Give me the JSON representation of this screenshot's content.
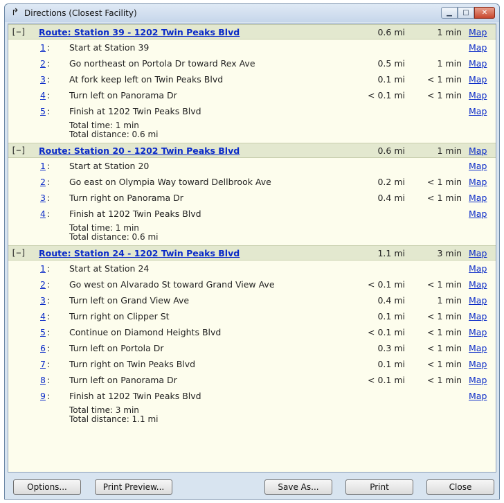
{
  "window": {
    "title": "Directions (Closest Facility)",
    "title_icon": "turn-arrow-icon",
    "controls": [
      "minimize",
      "maximize",
      "close"
    ]
  },
  "routes": [
    {
      "toggle": "[−]",
      "title": "Route: Station 39 - 1202 Twin Peaks Blvd",
      "distance": "0.6 mi",
      "time": "1 min",
      "map": "Map",
      "steps": [
        {
          "num": "1",
          "text": "Start at Station 39",
          "distance": "",
          "time": "",
          "map": "Map"
        },
        {
          "num": "2",
          "text": "Go northeast on Portola Dr toward Rex Ave",
          "distance": "0.5 mi",
          "time": "1 min",
          "map": "Map"
        },
        {
          "num": "3",
          "text": "At fork keep left on Twin Peaks Blvd",
          "distance": "0.1 mi",
          "time": "< 1 min",
          "map": "Map"
        },
        {
          "num": "4",
          "text": "Turn left on Panorama Dr",
          "distance": "< 0.1 mi",
          "time": "< 1 min",
          "map": "Map"
        },
        {
          "num": "5",
          "text": "Finish at 1202 Twin Peaks Blvd",
          "distance": "",
          "time": "",
          "map": "Map"
        }
      ],
      "total_time": "Total time: 1 min",
      "total_distance": "Total distance: 0.6 mi"
    },
    {
      "toggle": "[−]",
      "title": "Route: Station 20 - 1202 Twin Peaks Blvd",
      "distance": "0.6 mi",
      "time": "1 min",
      "map": "Map",
      "steps": [
        {
          "num": "1",
          "text": "Start at Station 20",
          "distance": "",
          "time": "",
          "map": "Map"
        },
        {
          "num": "2",
          "text": "Go east on Olympia Way toward Dellbrook Ave",
          "distance": "0.2 mi",
          "time": "< 1 min",
          "map": "Map"
        },
        {
          "num": "3",
          "text": "Turn right on Panorama Dr",
          "distance": "0.4 mi",
          "time": "< 1 min",
          "map": "Map"
        },
        {
          "num": "4",
          "text": "Finish at 1202 Twin Peaks Blvd",
          "distance": "",
          "time": "",
          "map": "Map"
        }
      ],
      "total_time": "Total time: 1 min",
      "total_distance": "Total distance: 0.6 mi"
    },
    {
      "toggle": "[−]",
      "title": "Route: Station 24 - 1202 Twin Peaks Blvd",
      "distance": "1.1 mi",
      "time": "3 min",
      "map": "Map",
      "steps": [
        {
          "num": "1",
          "text": "Start at Station 24",
          "distance": "",
          "time": "",
          "map": "Map"
        },
        {
          "num": "2",
          "text": "Go west on Alvarado St toward Grand View Ave",
          "distance": "< 0.1 mi",
          "time": "< 1 min",
          "map": "Map"
        },
        {
          "num": "3",
          "text": "Turn left on Grand View Ave",
          "distance": "0.4 mi",
          "time": "1 min",
          "map": "Map"
        },
        {
          "num": "4",
          "text": "Turn right on Clipper St",
          "distance": "0.1 mi",
          "time": "< 1 min",
          "map": "Map"
        },
        {
          "num": "5",
          "text": "Continue on Diamond Heights Blvd",
          "distance": "< 0.1 mi",
          "time": "< 1 min",
          "map": "Map"
        },
        {
          "num": "6",
          "text": "Turn left on Portola Dr",
          "distance": "0.3 mi",
          "time": "< 1 min",
          "map": "Map"
        },
        {
          "num": "7",
          "text": "Turn right on Twin Peaks Blvd",
          "distance": "0.1 mi",
          "time": "< 1 min",
          "map": "Map"
        },
        {
          "num": "8",
          "text": "Turn left on Panorama Dr",
          "distance": "< 0.1 mi",
          "time": "< 1 min",
          "map": "Map"
        },
        {
          "num": "9",
          "text": "Finish at 1202 Twin Peaks Blvd",
          "distance": "",
          "time": "",
          "map": "Map"
        }
      ],
      "total_time": "Total time: 3 min",
      "total_distance": "Total distance: 1.1 mi"
    }
  ],
  "buttons": {
    "options": "Options...",
    "print_preview": "Print Preview...",
    "save_as": "Save As...",
    "print": "Print",
    "close": "Close"
  },
  "colors": {
    "link": "#0a2ac8",
    "route_header_bg": "#e3e8cf",
    "list_bg": "#fdfded",
    "window_bg": "#d8e4f0"
  }
}
